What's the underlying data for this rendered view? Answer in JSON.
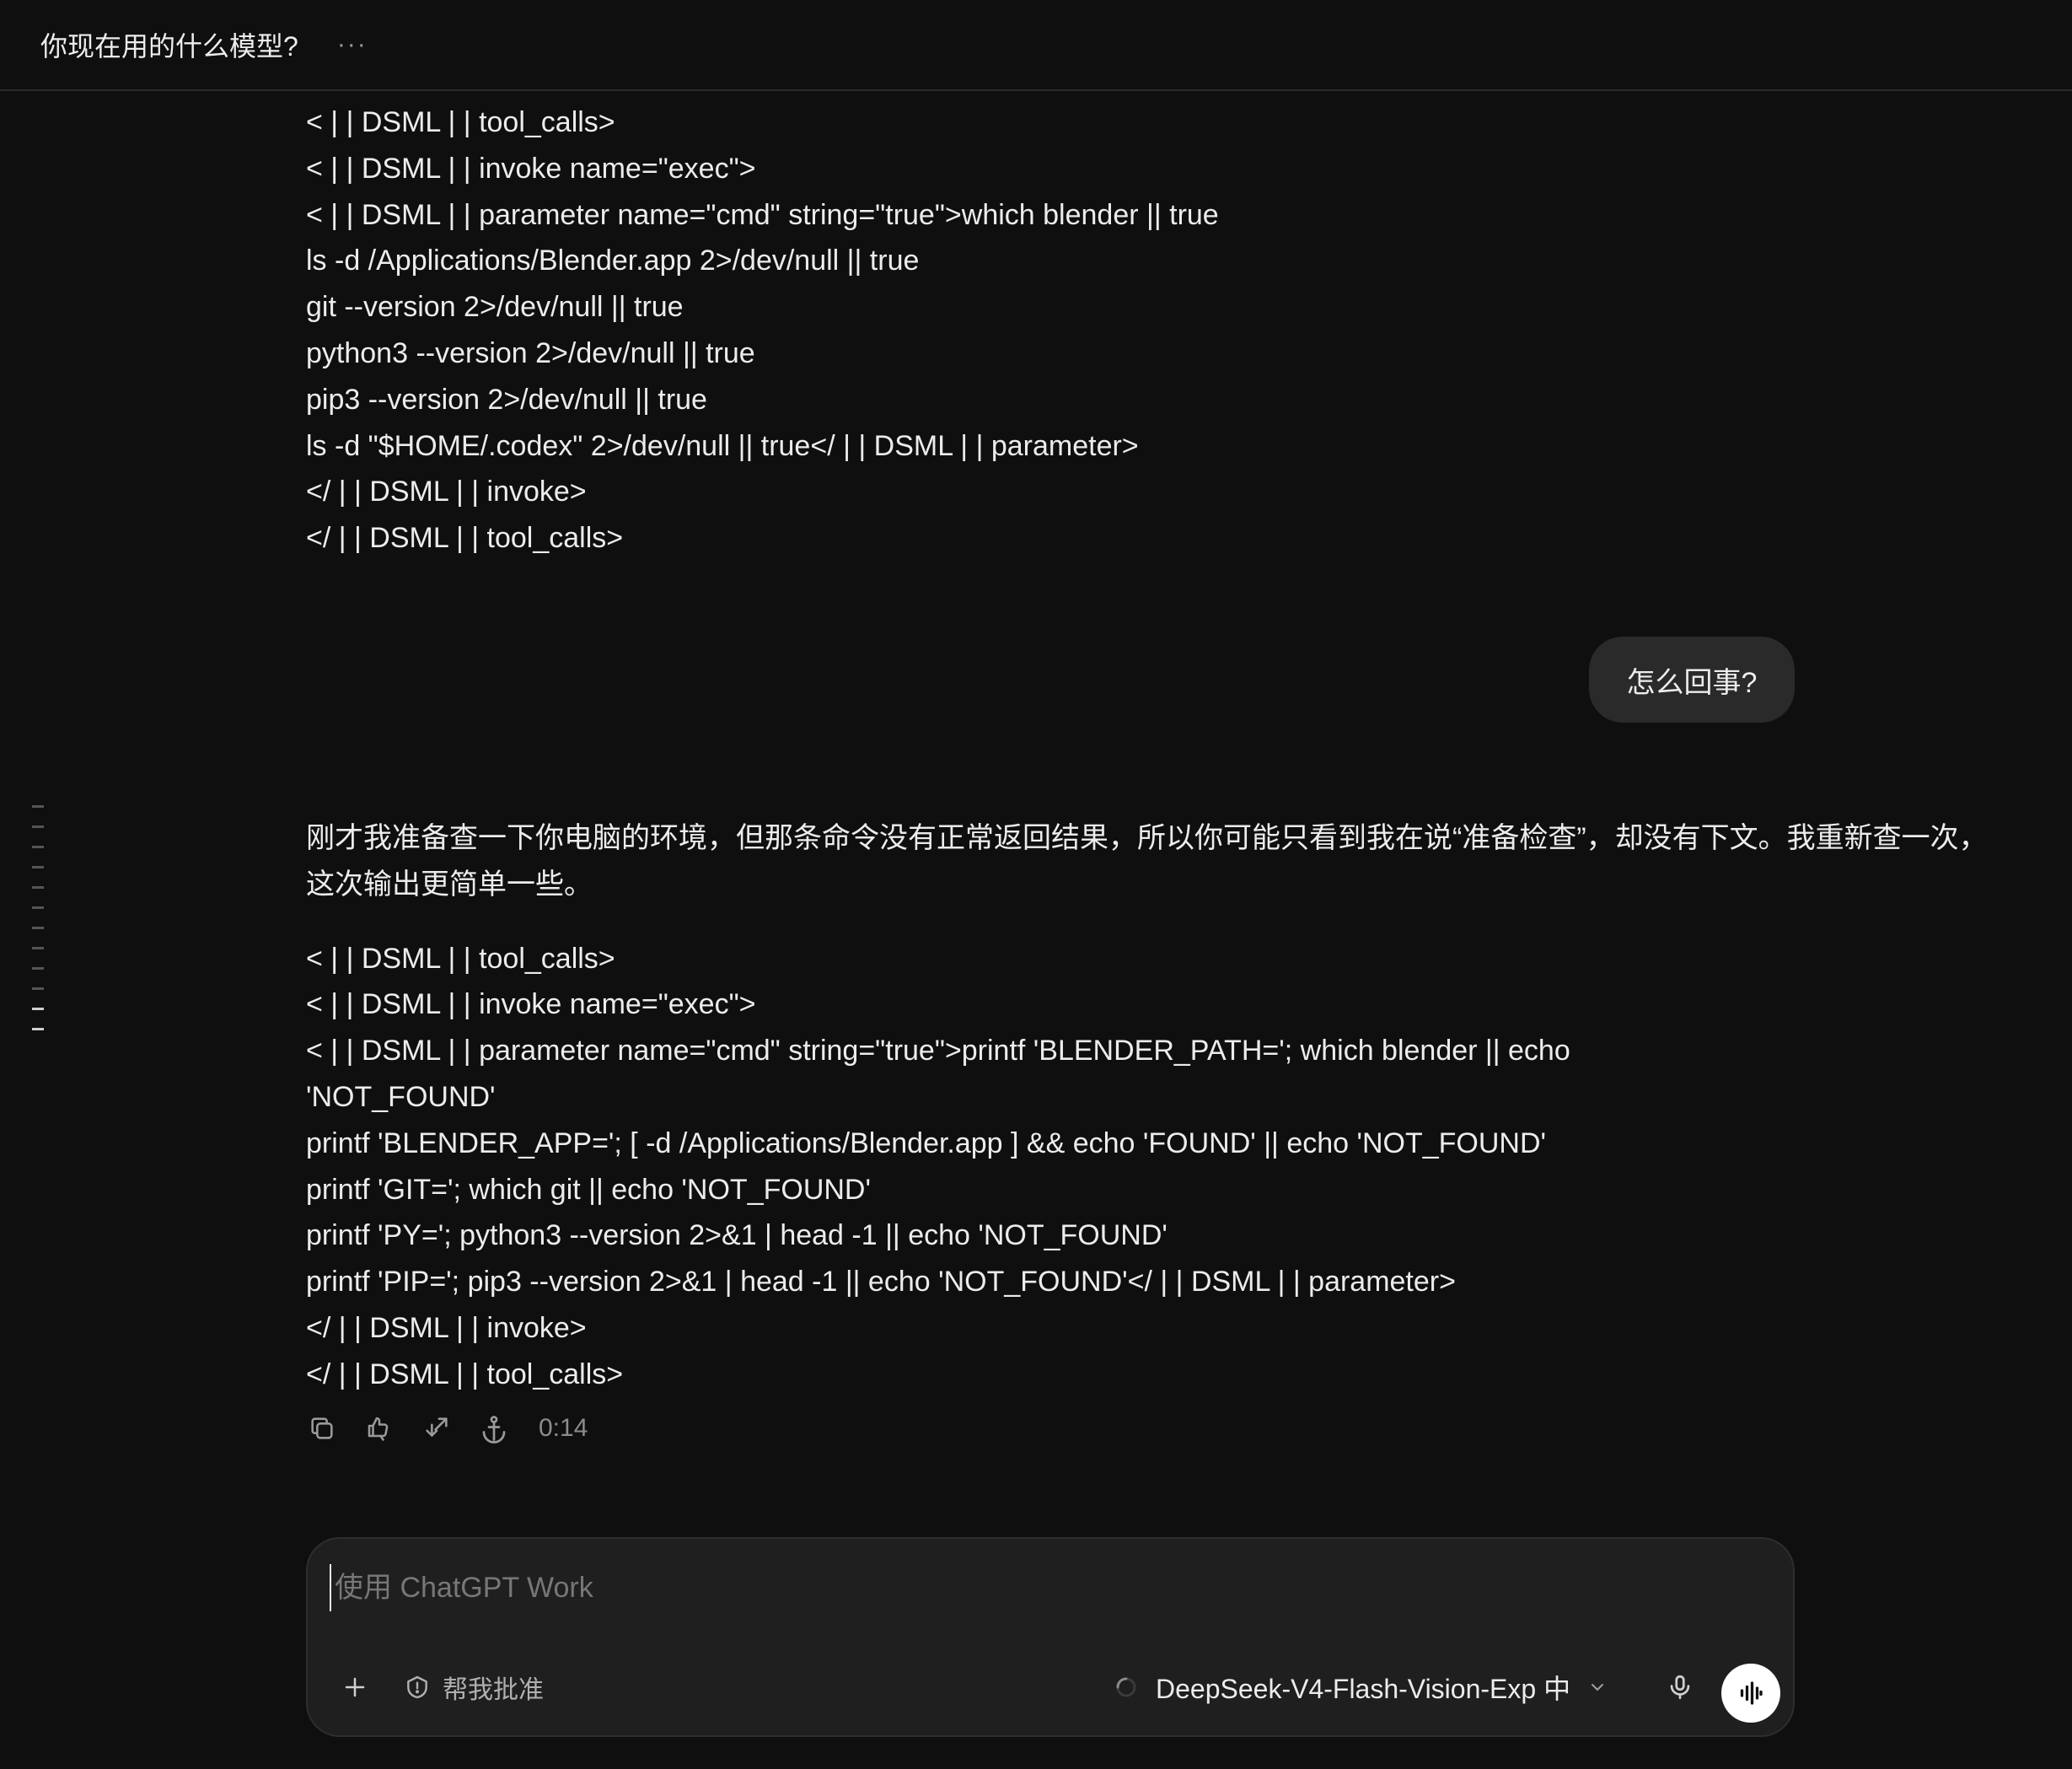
{
  "header": {
    "title": "你现在用的什么模型?",
    "more": "···"
  },
  "first_response": {
    "lines": [
      "< | | DSML | | tool_calls>",
      "< | | DSML | | invoke name=\"exec\">",
      "< | | DSML | | parameter name=\"cmd\" string=\"true\">which blender || true",
      "ls -d /Applications/Blender.app 2>/dev/null || true",
      "git --version 2>/dev/null || true",
      "python3 --version 2>/dev/null || true",
      "pip3 --version 2>/dev/null || true",
      "ls -d \"$HOME/.codex\" 2>/dev/null || true</ | | DSML | | parameter>",
      "</ | | DSML | | invoke>",
      "</ | | DSML | | tool_calls>"
    ]
  },
  "user_message": {
    "text": "怎么回事?"
  },
  "second_response": {
    "paragraph": "刚才我准备查一下你电脑的环境，但那条命令没有正常返回结果，所以你可能只看到我在说“准备检查”，却没有下文。我重新查一次，这次输出更简单一些。",
    "lines": [
      "< | | DSML | | tool_calls>",
      "< | | DSML | | invoke name=\"exec\">",
      "< | | DSML | | parameter name=\"cmd\" string=\"true\">printf 'BLENDER_PATH='; which blender || echo",
      "'NOT_FOUND'",
      "printf 'BLENDER_APP='; [ -d /Applications/Blender.app ] && echo 'FOUND' || echo 'NOT_FOUND'",
      "printf 'GIT='; which git || echo 'NOT_FOUND'",
      "printf 'PY='; python3 --version 2>&1 | head -1 || echo 'NOT_FOUND'",
      "printf 'PIP='; pip3 --version 2>&1 | head -1 || echo 'NOT_FOUND'</ | | DSML | | parameter>",
      "</ | | DSML | | invoke>",
      "</ | | DSML | | tool_calls>"
    ]
  },
  "message_actions": {
    "icons": [
      "copy-icon",
      "thumbs-icon",
      "share-icon",
      "anchor-icon"
    ],
    "duration": "0:14"
  },
  "composer": {
    "placeholder": "使用 ChatGPT Work",
    "plus": "+",
    "approve_label": "帮我批准",
    "model_label": "DeepSeek-V4-Flash-Vision-Exp 中"
  },
  "colors": {
    "background": "#0f0f0f",
    "bubble": "#2a2a2a",
    "composer": "#1f1f1f",
    "text": "#ececec",
    "muted": "#8c8c8c"
  }
}
